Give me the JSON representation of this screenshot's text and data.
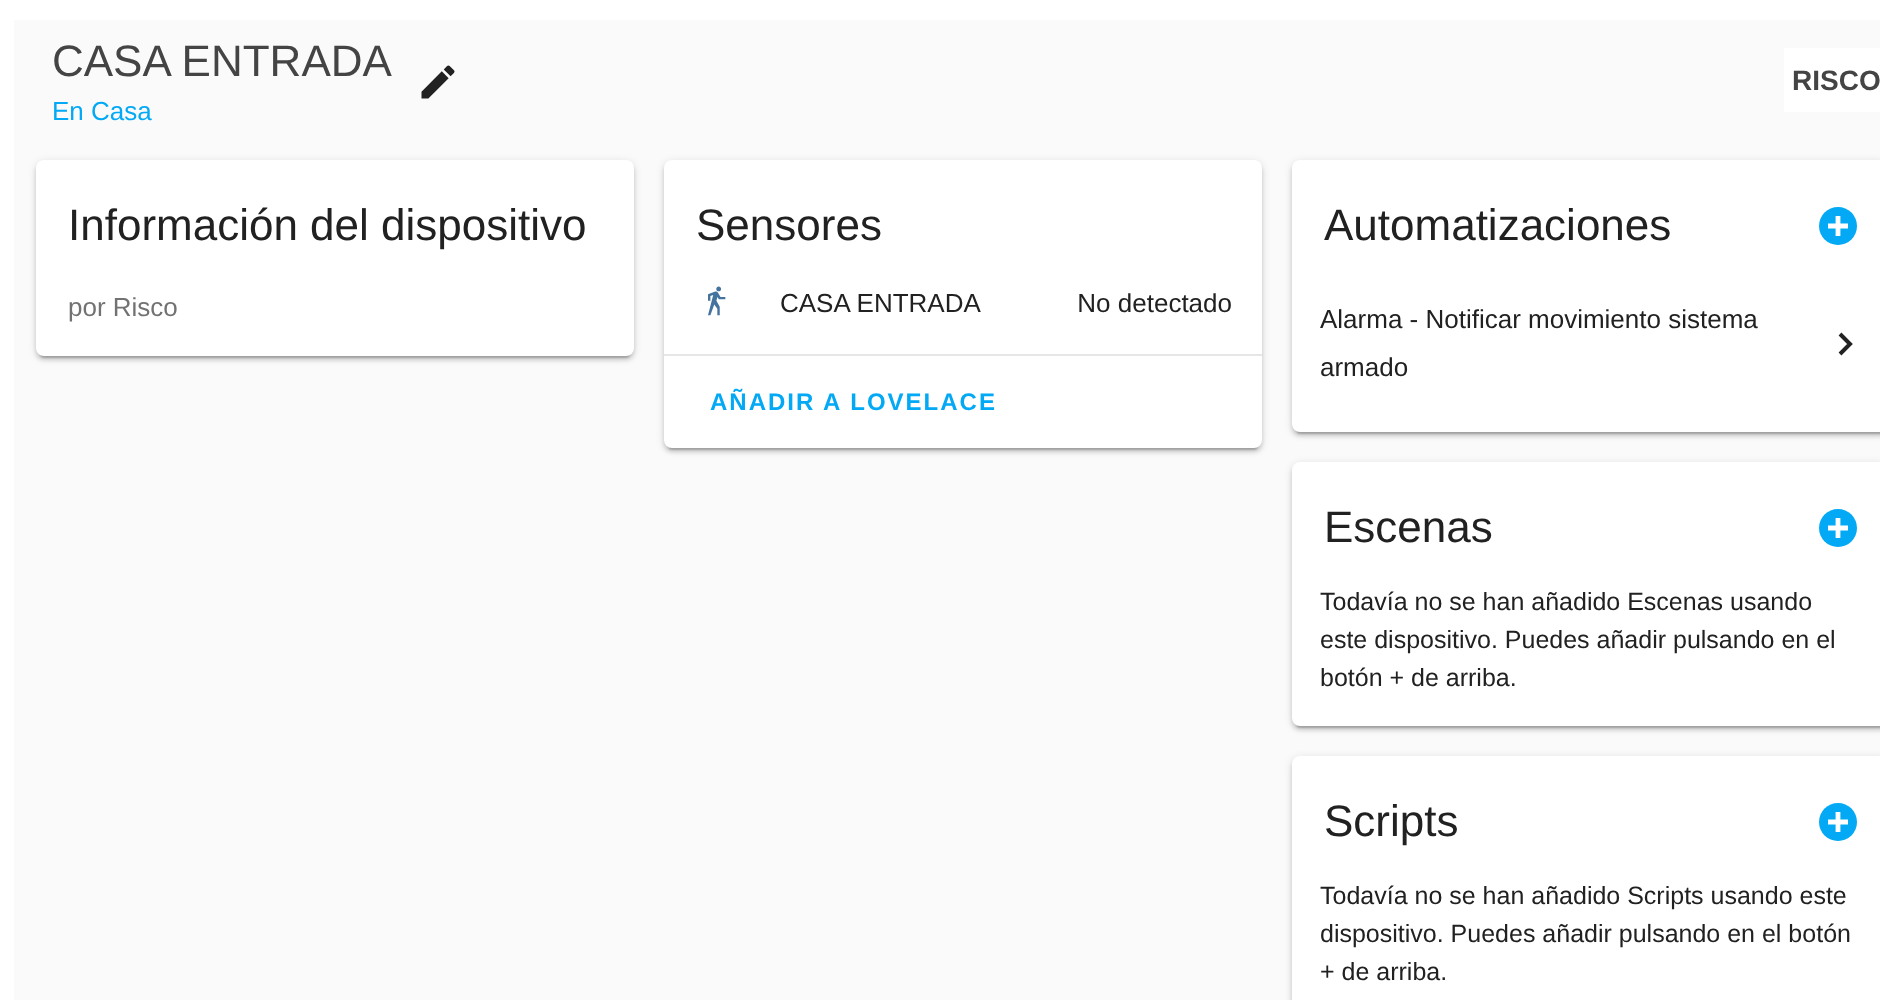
{
  "header": {
    "title": "CASA ENTRADA",
    "subtitle": "En Casa",
    "logo": "RISCO"
  },
  "device_info": {
    "title": "Información del dispositivo",
    "manufacturer": "por Risco"
  },
  "sensors": {
    "title": "Sensores",
    "items": [
      {
        "name": "CASA ENTRADA",
        "state": "No detectado"
      }
    ],
    "action": "AÑADIR A LOVELACE"
  },
  "sections": [
    {
      "kind": "list",
      "title": "Automatizaciones",
      "items": [
        "Alarma - Notificar movimiento sistema armado"
      ]
    },
    {
      "kind": "empty",
      "title": "Escenas",
      "message": "Todavía no se han añadido Escenas usando este dispositivo. Puedes añadir pulsando en el botón + de arriba."
    },
    {
      "kind": "empty",
      "title": "Scripts",
      "message": "Todavía no se han añadido Scripts usando este dispositivo. Puedes añadir pulsando en el botón + de arriba."
    }
  ]
}
